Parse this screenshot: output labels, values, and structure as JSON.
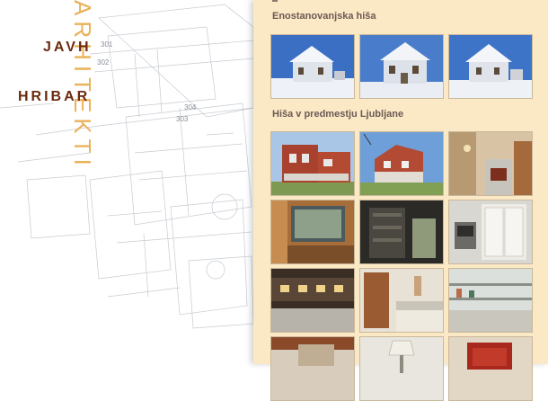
{
  "brand": {
    "line1": "JAVH",
    "line2": "HRIBAR",
    "vertical": "ARHITEKTI"
  },
  "sections": [
    {
      "title": "Enostanovanjska hiša",
      "thumbnails": [
        "snow-house-1",
        "snow-house-2",
        "snow-house-3"
      ]
    },
    {
      "title": "Hiša v predmestju Ljubljane",
      "thumbnails": [
        "red-house-exterior-1",
        "red-house-exterior-2",
        "living-room-fireplace",
        "hallway-window",
        "dark-shelving",
        "kitchen-oven",
        "kitchen-cabinets-lights",
        "wooden-door-counter",
        "counter-shelves",
        "living-room-sofa",
        "table-lamp",
        "red-armchair"
      ]
    }
  ],
  "colors": {
    "brand_dark": "#6b2a0e",
    "brand_accent": "#e9b25a",
    "panel_bg": "#fbe8c4",
    "section_title": "#6b5a55"
  }
}
